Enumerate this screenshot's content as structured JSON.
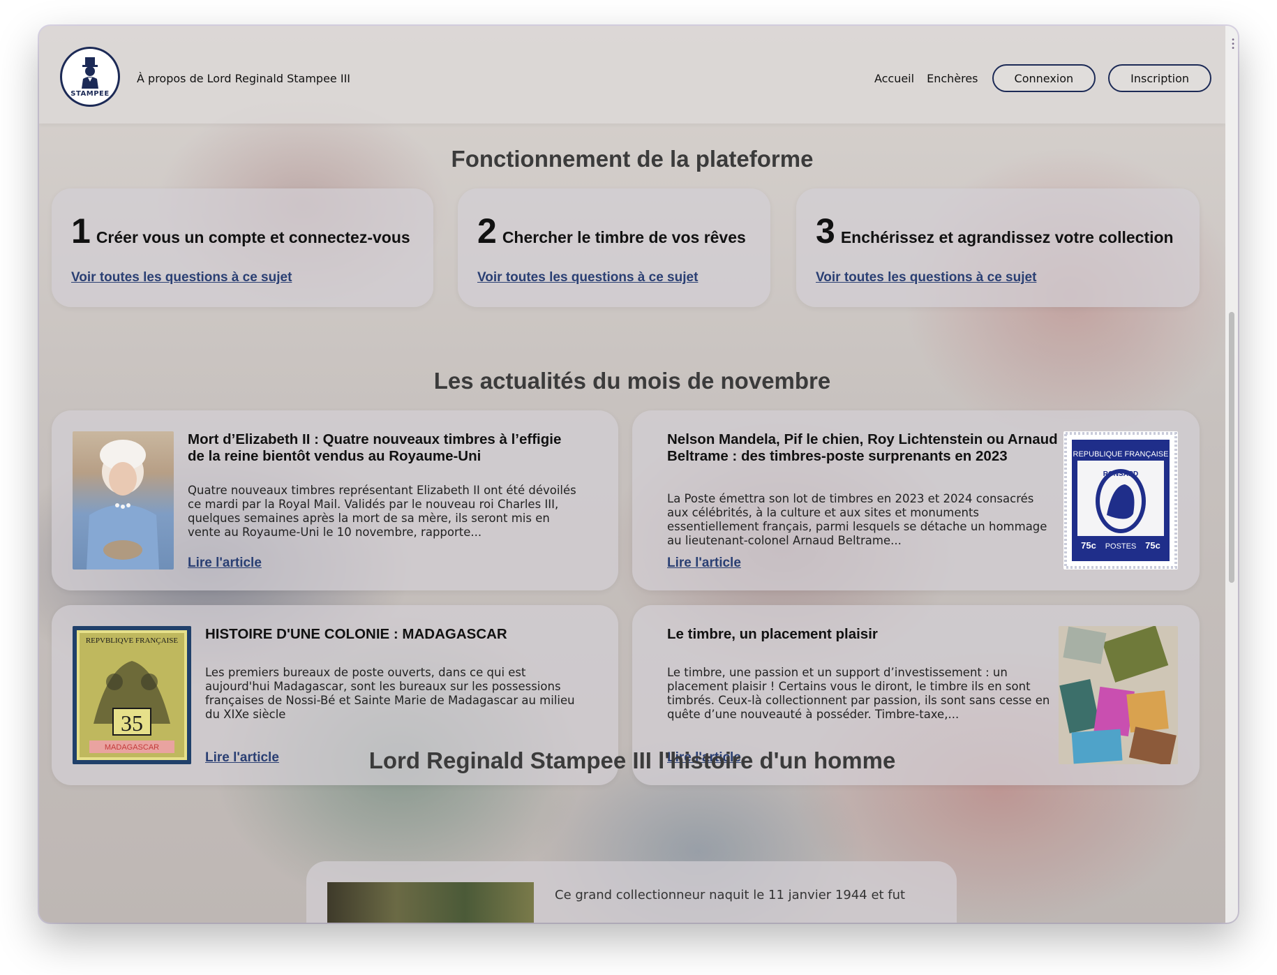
{
  "header": {
    "logo_text": "STAMPEE",
    "about_label": "À propos de Lord Reginald Stampee III",
    "nav": {
      "home_label": "Accueil",
      "auctions_label": "Enchères",
      "login_label": "Connexion",
      "signup_label": "Inscription"
    }
  },
  "platform": {
    "title": "Fonctionnement de la plateforme",
    "steps": [
      {
        "number": "1",
        "label": "Créer vous un compte et connectez-vous",
        "link": "Voir toutes les questions à ce sujet"
      },
      {
        "number": "2",
        "label": "Chercher le timbre de vos rêves",
        "link": "Voir toutes les questions à ce sujet"
      },
      {
        "number": "3",
        "label": "Enchérissez et agrandissez votre collection",
        "link": "Voir toutes les questions à ce sujet"
      }
    ]
  },
  "news": {
    "title": "Les actualités du mois de novembre",
    "articles": [
      {
        "title": "Mort d’Elizabeth II : Quatre nouveaux timbres à l’effigie de la reine bientôt vendus au Royaume-Uni",
        "description": "Quatre nouveaux timbres représentant Elizabeth II ont été dévoilés ce mardi par la Royal Mail. Validés par le nouveau roi Charles III, quelques semaines après la mort de sa mère, ils seront mis en vente au Royaume-Uni le 10 novembre, rapporte...",
        "link": "Lire l'article"
      },
      {
        "title": "Nelson Mandela, Pif le chien, Roy Lichtenstein ou Arnaud Beltrame : des timbres-poste surprenants en 2023",
        "description": "La Poste émettra son lot de timbres en 2023 et 2024 consacrés aux célébrités, à la culture et aux sites et monuments essentiellement français, parmi lesquels se détache un hommage au lieutenant-colonel Arnaud Beltrame...",
        "link": "Lire l'article",
        "stamp_text": {
          "top": "REPUBLIQUE FRANÇAISE",
          "name": "RONSARD",
          "value": "75c",
          "bottom": "POSTES"
        }
      },
      {
        "title": "HISTOIRE D'UNE COLONIE : MADAGASCAR",
        "description": "Les premiers bureaux de poste ouverts, dans ce qui est aujourd'hui Madagascar, sont les bureaux sur les possessions françaises de Nossi-Bé et Sainte Marie de Madagascar au milieu du XIXe siècle",
        "link": "Lire l'article",
        "stamp_text": {
          "top": "REPVBLIQVE FRANÇAISE",
          "value": "35",
          "bottom": "MADAGASCAR"
        }
      },
      {
        "title": "Le timbre, un placement plaisir",
        "description": "Le timbre, une passion et un support d’investissement : un placement plaisir ! Certains vous le diront, le timbre ils en sont timbrés. Ceux-là collectionnent par passion, ils sont sans cesse en quête d’une nouveauté à posséder. Timbre-taxe,...",
        "link": "Lire l'article"
      }
    ]
  },
  "biography": {
    "title": "Lord Reginald Stampee III l'histoire d'un homme",
    "intro": "Ce grand collectionneur naquit le 11 janvier 1944 et fut"
  },
  "colors": {
    "navy": "#1c2a56",
    "link": "#2a3f73",
    "heading": "#3b3b3b"
  }
}
